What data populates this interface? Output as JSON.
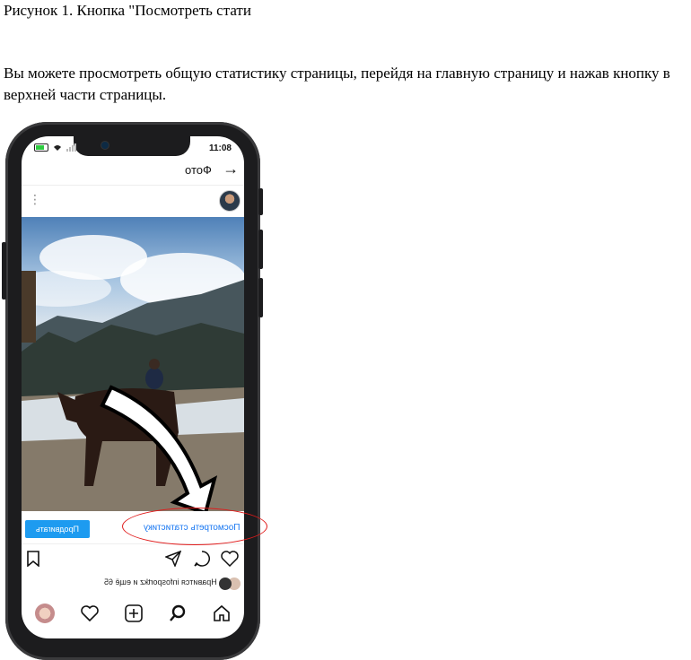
{
  "caption": "Рисунок 1. Кнопка \"Посмотреть стати",
  "paragraph": "Вы можете просмотреть общую статистику страницы, перейдя на главную страницу и нажав кнопку в верхней части страницы.",
  "phone": {
    "time": "11:08",
    "header_title": "Фото",
    "promote_label": "Продвигать",
    "stats_label": "Посмотреть статистику",
    "likes_text": "Нравится infosportkz и ещё 65"
  },
  "colors": {
    "accent": "#1d9bf0",
    "highlight": "#e01b1b"
  }
}
